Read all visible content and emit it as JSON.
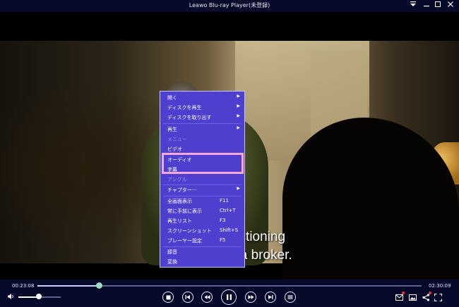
{
  "window": {
    "title": "Leawo Blu-ray Player(未登録)"
  },
  "video": {
    "subtitle_line1": "We are functioning",
    "subtitle_line2": "as a type of a broker."
  },
  "context_menu": {
    "items": [
      {
        "label": "開く",
        "submenu": true,
        "enabled": true
      },
      {
        "label": "ディスクを再生",
        "submenu": true,
        "enabled": true
      },
      {
        "label": "ディスクを取り出す",
        "submenu": true,
        "enabled": true
      },
      {
        "label": "再生",
        "submenu": true,
        "enabled": true
      },
      {
        "label": "メニュー",
        "submenu": false,
        "enabled": false
      },
      {
        "label": "ビデオ",
        "submenu": false,
        "enabled": true
      },
      {
        "label": "オーディオ",
        "submenu": false,
        "enabled": true
      },
      {
        "label": "字幕",
        "submenu": false,
        "enabled": true
      },
      {
        "label": "アングル",
        "submenu": false,
        "enabled": false
      },
      {
        "label": "チャプター···",
        "submenu": true,
        "enabled": true
      },
      {
        "label": "全画面表示",
        "shortcut": "F11",
        "enabled": true
      },
      {
        "label": "常に手前に表示",
        "shortcut": "Ctrl+T",
        "enabled": true
      },
      {
        "label": "再生リスト",
        "shortcut": "F3",
        "enabled": true
      },
      {
        "label": "スクリーンショット",
        "shortcut": "Shift+S",
        "enabled": true
      },
      {
        "label": "プレーヤー設定",
        "shortcut": "F5",
        "enabled": true
      },
      {
        "label": "録音",
        "enabled": true
      },
      {
        "label": "変換",
        "enabled": true
      }
    ],
    "highlight_color": "#f7a8d8"
  },
  "player": {
    "elapsed": "00:23:08",
    "total": "02:30:09",
    "progress_fraction": 0.16,
    "volume_fraction": 0.48
  },
  "icons": {
    "minimize": "minimize-icon",
    "restore": "restore-icon",
    "close": "close-icon",
    "dropdown": "dropdown-icon",
    "volume": "volume-icon",
    "stop": "stop-icon",
    "previous": "previous-icon",
    "rewind": "rewind-icon",
    "play_pause": "pause-icon",
    "forward": "fast-forward-icon",
    "next": "next-icon",
    "playlist": "playlist-icon"
  },
  "colors": {
    "menu_bg": "#4e3fcf",
    "bar_bg": "#07092a"
  }
}
